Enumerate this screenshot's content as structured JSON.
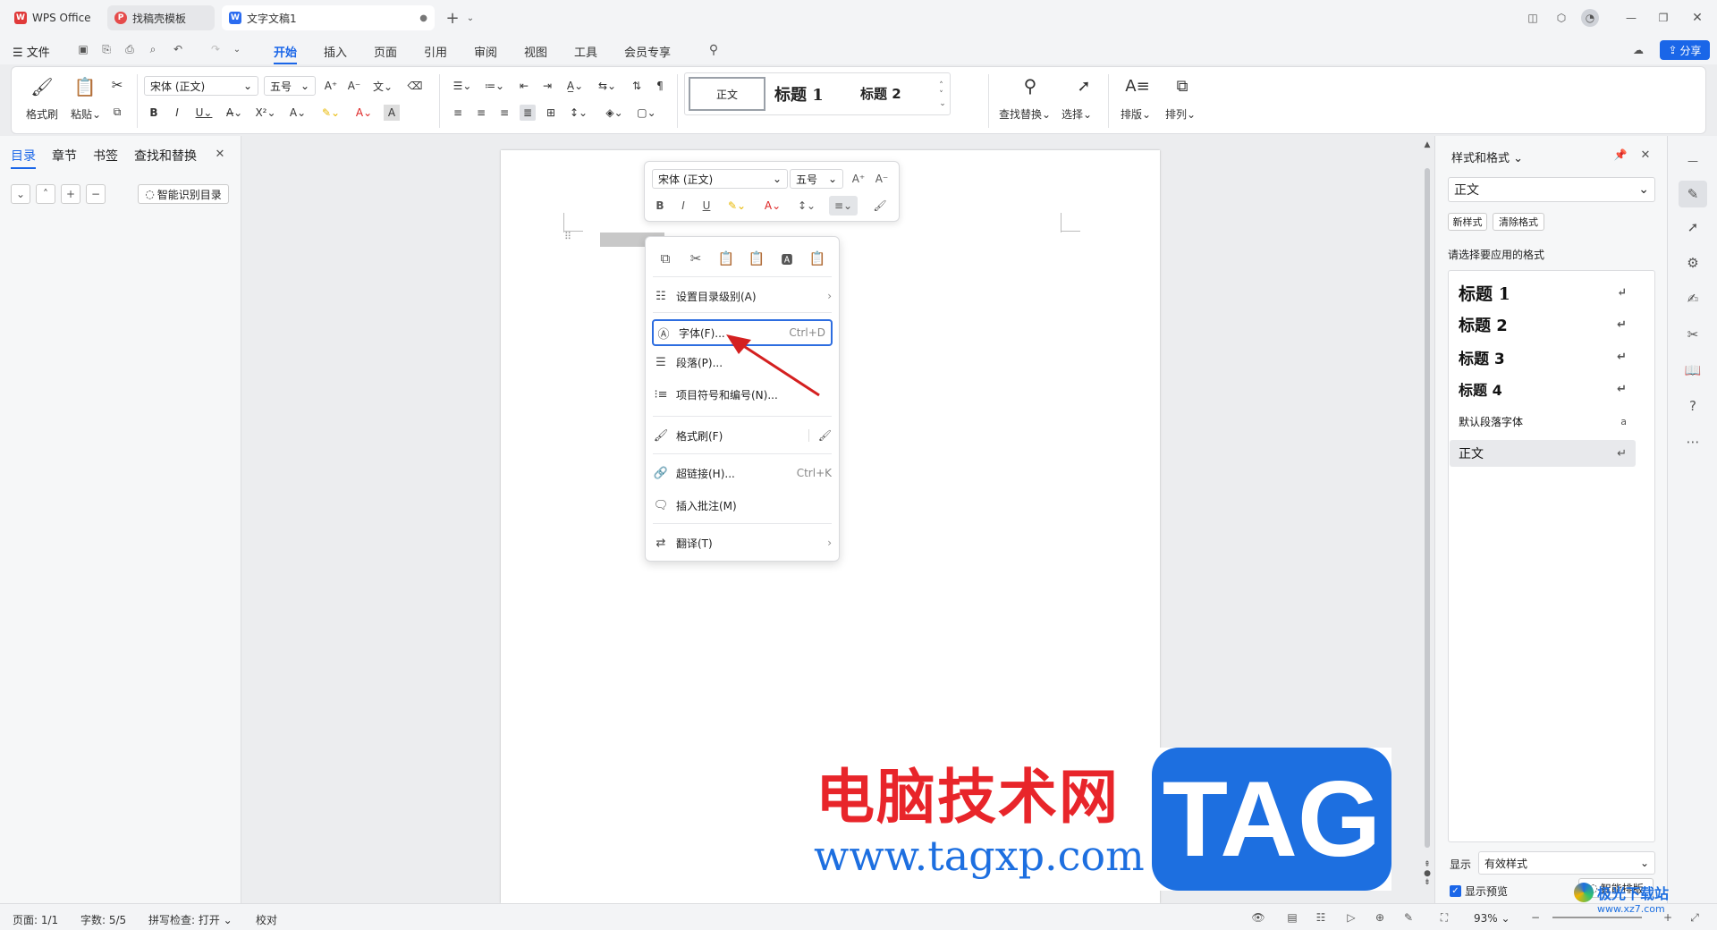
{
  "tabs": [
    {
      "label": "WPS Office",
      "logo": "W"
    },
    {
      "label": "找稿壳模板",
      "logo": "P"
    },
    {
      "label": "文字文稿1",
      "logo": "W"
    }
  ],
  "menu": {
    "file": "文件",
    "tabs": [
      "开始",
      "插入",
      "页面",
      "引用",
      "审阅",
      "视图",
      "工具",
      "会员专享"
    ],
    "share": "分享"
  },
  "ribbon": {
    "format_painter": "格式刷",
    "paste": "粘贴",
    "font_name": "宋体 (正文)",
    "font_size": "五号",
    "styles": {
      "normal": "正文",
      "h1": "标题 1",
      "h2": "标题 2"
    },
    "find_replace": "查找替换",
    "select": "选择",
    "typeset": "排版",
    "arrange": "排列"
  },
  "nav": {
    "tabs": [
      "目录",
      "章节",
      "书签",
      "查找和替换"
    ],
    "smart_toc": "智能识别目录"
  },
  "mini_toolbar": {
    "font_name": "宋体 (正文)",
    "font_size": "五号"
  },
  "context_menu": {
    "set_toc_level": "设置目录级别(A)",
    "font": "字体(F)...",
    "font_shortcut": "Ctrl+D",
    "paragraph": "段落(P)...",
    "bullets": "项目符号和编号(N)...",
    "format_painter": "格式刷(F)",
    "hyperlink": "超链接(H)...",
    "hyperlink_shortcut": "Ctrl+K",
    "comment": "插入批注(M)",
    "translate": "翻译(T)"
  },
  "styles_panel": {
    "title": "样式和格式",
    "current": "正文",
    "new_style": "新样式",
    "clear_format": "清除格式",
    "hint": "请选择要应用的格式",
    "items": [
      "标题 1",
      "标题 2",
      "标题 3",
      "标题 4",
      "默认段落字体",
      "正文"
    ],
    "show_label": "显示",
    "show_value": "有效样式",
    "preview_label": "显示预览",
    "smart_layout": "智能排版"
  },
  "status": {
    "page": "页面: 1/1",
    "words": "字数: 5/5",
    "spell": "拼写检查: 打开",
    "proof": "校对",
    "zoom": "93%"
  },
  "watermark": {
    "cn": "电脑技术网",
    "url": "www.tagxp.com",
    "tag": "TAG",
    "corner": "极光下载站",
    "corner_url": "www.xz7.com"
  },
  "colors": {
    "accent": "#1a66e8",
    "wps_red": "#e03a3a",
    "watermark_red": "#e8252a",
    "watermark_blue": "#1d6fe0"
  }
}
